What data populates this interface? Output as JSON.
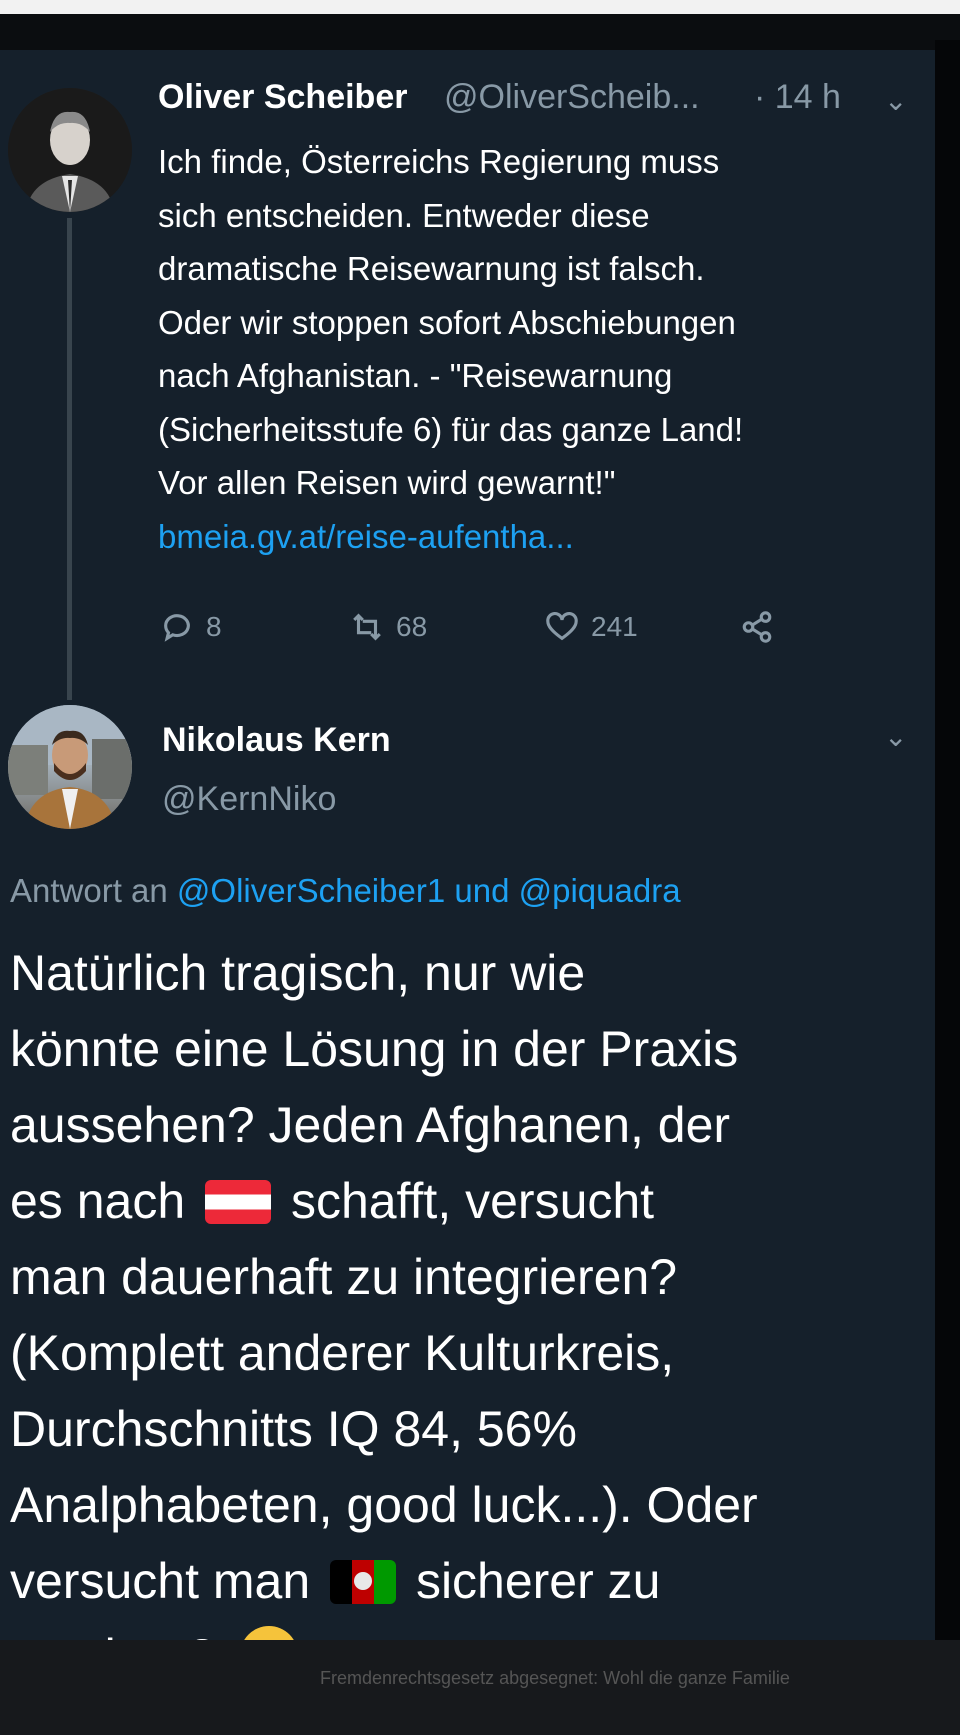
{
  "tweet": {
    "author_name": "Oliver Scheiber",
    "author_handle": "@OliverScheib...",
    "time": "· 14 h",
    "lines": [
      "Ich finde, Österreichs Regierung muss",
      "sich entscheiden. Entweder diese",
      "dramatische Reisewarnung ist falsch.",
      "Oder wir stoppen sofort Abschiebungen",
      "nach Afghanistan. - \"Reisewarnung",
      "(Sicherheitsstufe 6) für das ganze Land!",
      "Vor allen Reisen wird gewarnt!\""
    ],
    "link": "bmeia.gv.at/reise-aufentha...",
    "replies": "8",
    "retweets": "68",
    "likes": "241"
  },
  "reply": {
    "author_name": "Nikolaus Kern",
    "author_handle": "@KernNiko",
    "replying_prefix": "Antwort an",
    "mention1": "@OliverScheiber1",
    "connector": "und",
    "mention2": "@piquadra",
    "lines": {
      "l1": "Natürlich tragisch, nur wie",
      "l2": "könnte eine Lösung in der Praxis",
      "l3": "aussehen? Jeden Afghanen, der",
      "l4a": "es nach",
      "l4b": "schafft, versucht",
      "l5": "man dauerhaft zu integrieren?",
      "l6": "(Komplett anderer Kulturkreis,",
      "l7": "Durchschnitts IQ 84, 56%",
      "l8": "Analphabeten, good luck...). Oder",
      "l9a": "versucht man",
      "l9b": "sicherer zu",
      "l10": "machen?"
    }
  },
  "background_text": "Fremdenrechtsgesetz abgesegnet: Wohl die ganze Familie"
}
